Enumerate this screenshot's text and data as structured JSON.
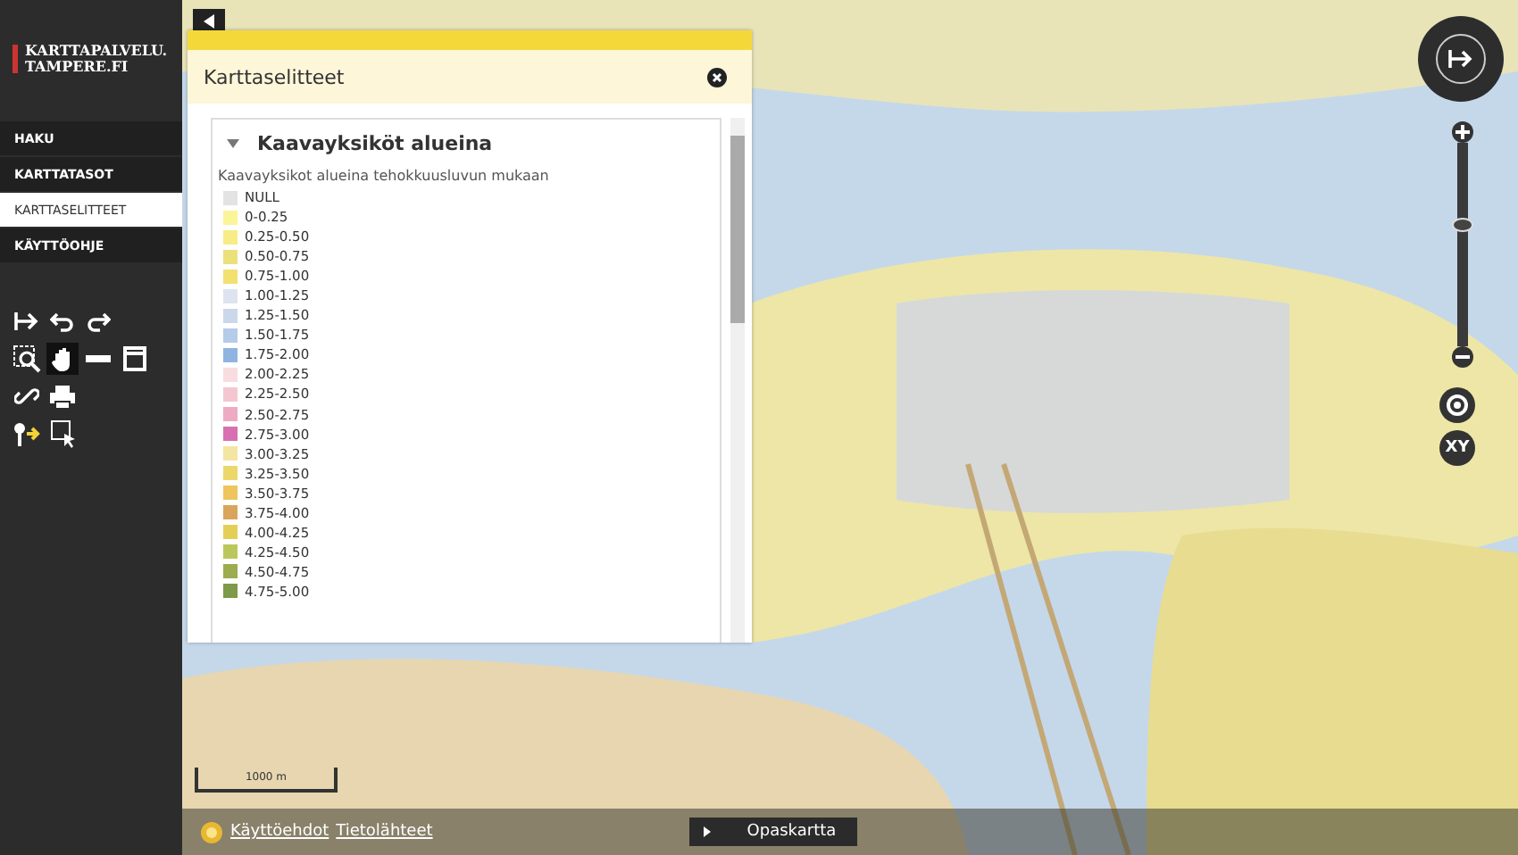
{
  "logo": {
    "line1": "KARTTAPALVELU.",
    "line2": "TAMPERE.FI"
  },
  "nav": [
    {
      "label": "HAKU",
      "selected": false
    },
    {
      "label": "KARTTATASOT",
      "selected": false
    },
    {
      "label": "KARTTASELITTEET",
      "selected": true
    },
    {
      "label": "KÄYTTÖOHJE",
      "selected": false
    }
  ],
  "tools": [
    [
      {
        "kind": "home",
        "selected": false
      },
      {
        "kind": "undo",
        "selected": false
      },
      {
        "kind": "redo",
        "selected": false
      }
    ],
    [
      {
        "kind": "zoombox",
        "selected": false
      },
      {
        "kind": "pan",
        "selected": true
      },
      {
        "kind": "measure",
        "selected": false
      },
      {
        "kind": "area",
        "selected": false
      }
    ],
    [
      {
        "kind": "link",
        "selected": false
      },
      {
        "kind": "print",
        "selected": false
      }
    ],
    [
      {
        "kind": "pin",
        "selected": false
      },
      {
        "kind": "select",
        "selected": false
      }
    ]
  ],
  "panel": {
    "title": "Karttaselitteet",
    "section": {
      "title": "Kaavayksiköt alueina",
      "expanded": true,
      "subtitle": "Kaavayksikot alueina tehokkuusluvun mukaan",
      "items": [
        {
          "label": "NULL",
          "color": "#e3e3e3"
        },
        {
          "label": "0-0.25",
          "color": "#fbf59a"
        },
        {
          "label": "0.25-0.50",
          "color": "#f7ec85"
        },
        {
          "label": "0.50-0.75",
          "color": "#ece07a"
        },
        {
          "label": "0.75-1.00",
          "color": "#f2e070"
        },
        {
          "label": "1.00-1.25",
          "color": "#dde4ef"
        },
        {
          "label": "1.25-1.50",
          "color": "#cad8ea"
        },
        {
          "label": "1.50-1.75",
          "color": "#b4cbea"
        },
        {
          "label": "1.75-2.00",
          "color": "#8fb4e2"
        },
        {
          "label": "2.00-2.25",
          "color": "#f8dde0"
        },
        {
          "label": "2.25-2.50",
          "color": "#f4c7d0"
        },
        {
          "label": "2.50-2.75",
          "color": "#eeaac3"
        },
        {
          "label": "2.75-3.00",
          "color": "#d86fb0"
        },
        {
          "label": "3.00-3.25",
          "color": "#f2e6a2"
        },
        {
          "label": "3.25-3.50",
          "color": "#ecd86a"
        },
        {
          "label": "3.50-3.75",
          "color": "#edc55c"
        },
        {
          "label": "3.75-4.00",
          "color": "#d9a55a"
        },
        {
          "label": "4.00-4.25",
          "color": "#e3cf55"
        },
        {
          "label": "4.25-4.50",
          "color": "#bcc75b"
        },
        {
          "label": "4.50-4.75",
          "color": "#9cac4f"
        },
        {
          "label": "4.75-5.00",
          "color": "#7f9a48"
        }
      ]
    }
  },
  "zoom": {
    "level": 0.6
  },
  "coordinates_button": "XY",
  "scale": "1000 m",
  "footer": {
    "links": [
      "Käyttöehdot",
      "Tietolähteet"
    ],
    "button": "Opaskartta"
  }
}
